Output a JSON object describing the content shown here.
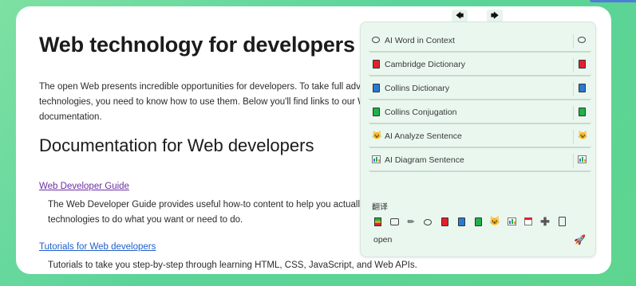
{
  "document": {
    "title": "Web technology for developers",
    "intro_line1": "The open Web presents incredible opportunities for developers. To take full adva",
    "intro_line2": "technologies, you need to know how to use them. Below you'll find links to our W",
    "intro_line3": "documentation.",
    "section_title": "Documentation for Web developers",
    "link1": "Web Developer Guide",
    "link1_desc_line1": "The Web Developer Guide provides useful how-to content to help you actually",
    "link1_desc_line2": "technologies to do what you want or need to do.",
    "link2": "Tutorials for Web developers",
    "link2_desc": "Tutorials to take you step-by-step through learning HTML, CSS, JavaScript, and Web APIs."
  },
  "popup": {
    "nav_prev_icon": "arrow-left-icon",
    "nav_prev": "🡄",
    "nav_next_icon": "arrow-right-icon",
    "nav_next": "🡆",
    "items": [
      {
        "label": "AI Word in Context",
        "icon": "speech-bubble-icon"
      },
      {
        "label": "Cambridge Dictionary",
        "icon": "red-book-icon",
        "color": "#e3202b"
      },
      {
        "label": "Collins Dictionary",
        "icon": "blue-book-icon",
        "color": "#2a7ad4"
      },
      {
        "label": "Collins Conjugation",
        "icon": "green-book-icon",
        "color": "#1fb24a"
      },
      {
        "label": "AI Analyze Sentence",
        "icon": "cat-icon"
      },
      {
        "label": "AI Diagram Sentence",
        "icon": "bar-chart-icon"
      }
    ],
    "translate_label": "翻译",
    "open_label": "open",
    "open_icon": "rocket-icon"
  }
}
